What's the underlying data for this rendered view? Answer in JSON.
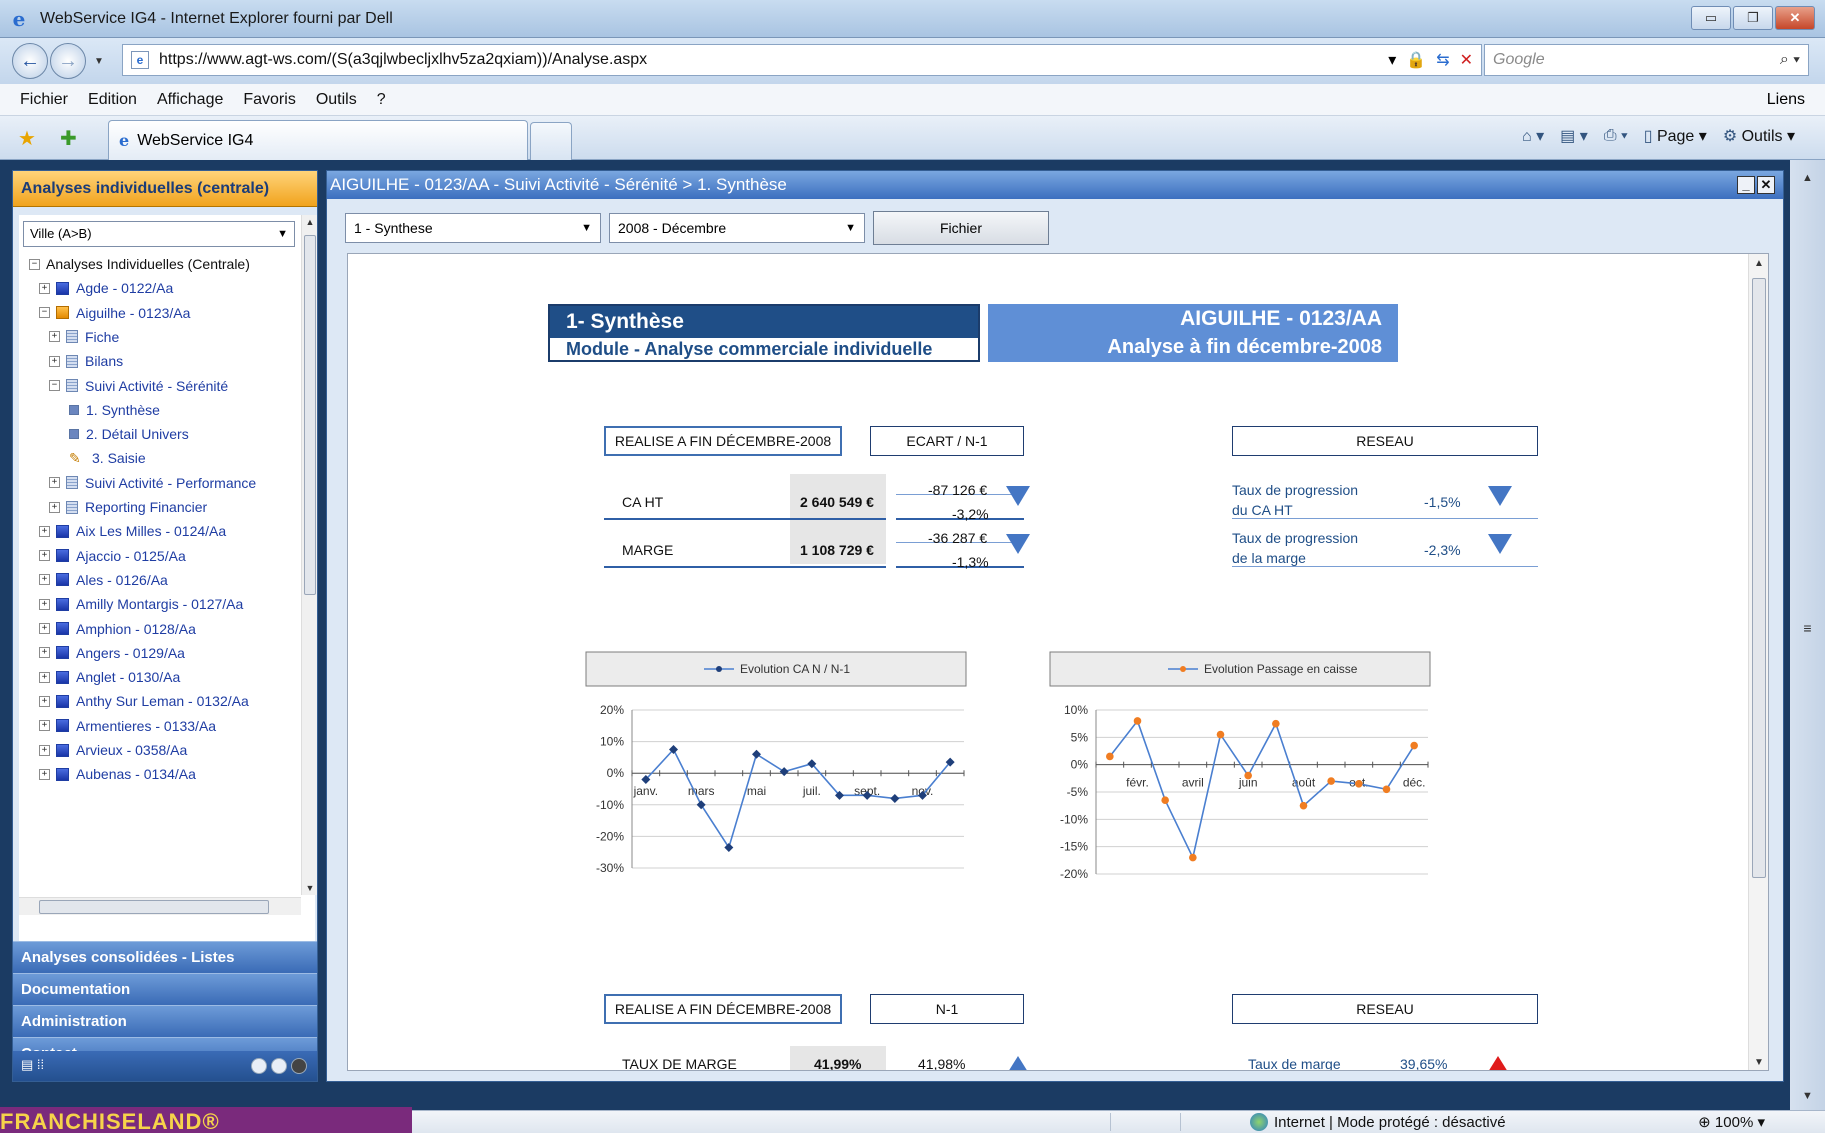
{
  "window": {
    "title": "WebService IG4 - Internet Explorer fourni par Dell",
    "minimize": "▭",
    "maximize": "❐",
    "close": "✕"
  },
  "addressbar": {
    "url": "https://www.agt-ws.com/(S(a3qjlwbecljxlhv5za2qxiam))/Analyse.aspx",
    "search_placeholder": "Google",
    "back_icon": "arrow-left",
    "forward_icon": "arrow-right"
  },
  "menubar": {
    "items": [
      "Fichier",
      "Edition",
      "Affichage",
      "Favoris",
      "Outils",
      "?"
    ],
    "liens": "Liens"
  },
  "tabs": {
    "active": "WebService IG4"
  },
  "commandbar": {
    "page": "Page",
    "outils": "Outils"
  },
  "leftpanel": {
    "header": "Analyses individuelles (centrale)",
    "city_select": "Ville (A>B)",
    "tree": [
      {
        "label": "Analyses Individuelles (Centrale)",
        "exp": "−",
        "icon": "none",
        "level": 0,
        "root": true
      },
      {
        "label": "Agde - 0122/Aa",
        "exp": "+",
        "icon": "blue",
        "level": 1
      },
      {
        "label": "Aiguilhe - 0123/Aa",
        "exp": "−",
        "icon": "orange",
        "level": 1
      },
      {
        "label": "Fiche",
        "exp": "+",
        "icon": "page",
        "level": 2
      },
      {
        "label": "Bilans",
        "exp": "+",
        "icon": "page",
        "level": 2
      },
      {
        "label": "Suivi Activité - Sérénité",
        "exp": "−",
        "icon": "page",
        "level": 2
      },
      {
        "label": "1. Synthèse",
        "exp": "",
        "icon": "small",
        "level": 3
      },
      {
        "label": "2. Détail Univers",
        "exp": "",
        "icon": "small",
        "level": 3
      },
      {
        "label": "3. Saisie",
        "exp": "",
        "icon": "pencil",
        "level": 3
      },
      {
        "label": "Suivi Activité - Performance",
        "exp": "+",
        "icon": "page",
        "level": 2
      },
      {
        "label": "Reporting Financier",
        "exp": "+",
        "icon": "page",
        "level": 2
      },
      {
        "label": "Aix Les Milles - 0124/Aa",
        "exp": "+",
        "icon": "blue",
        "level": 1
      },
      {
        "label": "Ajaccio - 0125/Aa",
        "exp": "+",
        "icon": "blue",
        "level": 1
      },
      {
        "label": "Ales - 0126/Aa",
        "exp": "+",
        "icon": "blue",
        "level": 1
      },
      {
        "label": "Amilly Montargis - 0127/Aa",
        "exp": "+",
        "icon": "blue",
        "level": 1
      },
      {
        "label": "Amphion - 0128/Aa",
        "exp": "+",
        "icon": "blue",
        "level": 1
      },
      {
        "label": "Angers - 0129/Aa",
        "exp": "+",
        "icon": "blue",
        "level": 1
      },
      {
        "label": "Anglet - 0130/Aa",
        "exp": "+",
        "icon": "blue",
        "level": 1
      },
      {
        "label": "Anthy Sur Leman - 0132/Aa",
        "exp": "+",
        "icon": "blue",
        "level": 1
      },
      {
        "label": "Armentieres - 0133/Aa",
        "exp": "+",
        "icon": "blue",
        "level": 1
      },
      {
        "label": "Arvieux - 0358/Aa",
        "exp": "+",
        "icon": "blue",
        "level": 1
      },
      {
        "label": "Aubenas - 0134/Aa",
        "exp": "+",
        "icon": "blue",
        "level": 1
      }
    ],
    "sections": [
      "Analyses consolidées - Listes",
      "Documentation",
      "Administration",
      "Contact"
    ]
  },
  "main": {
    "title": "AIGUILHE - 0123/AA - Suivi Activité - Sérénité > 1. Synthèse",
    "select_report": "1 - Synthese",
    "select_period": "2008 - Décembre",
    "fichier_button": "Fichier",
    "header_left_title": "1- Synthèse",
    "header_left_sub": "Module - Analyse commerciale individuelle",
    "header_right_title": "AIGUILHE - 0123/AA",
    "header_right_sub": "Analyse à fin décembre-2008",
    "section1": {
      "label_realise": "REALISE A FIN DÉCEMBRE-2008",
      "label_ecart": "ECART / N-1",
      "label_reseau": "RESEAU",
      "rows": [
        {
          "label": "CA HT",
          "value": "2 640 549 €",
          "ecart_abs": "-87 126 €",
          "ecart_pct": "-3,2%"
        },
        {
          "label": "MARGE",
          "value": "1 108 729 €",
          "ecart_abs": "-36 287 €",
          "ecart_pct": "-1,3%"
        }
      ],
      "reseau_rows": [
        {
          "label_l1": "Taux de progression",
          "label_l2": "du CA HT",
          "value": "-1,5%"
        },
        {
          "label_l1": "Taux de progression",
          "label_l2": "de la marge",
          "value": "-2,3%"
        }
      ]
    },
    "section2": {
      "label_realise": "REALISE A FIN DÉCEMBRE-2008",
      "label_n1": "N-1",
      "label_reseau": "RESEAU",
      "row": {
        "label": "TAUX DE MARGE",
        "value": "41,99%",
        "n1": "41,98%",
        "reseau_label": "Taux de marge",
        "reseau_value": "39,65%"
      }
    },
    "colors": {
      "line_ca": "#4a7fd0",
      "marker_ca": "#1f3f7a",
      "marker_passage": "#f07d22",
      "arrow": "#4476c4",
      "arrow_up_red": "#e01b1b"
    }
  },
  "chart_data": [
    {
      "type": "line",
      "legend": "Evolution CA N  / N-1",
      "categories": [
        "janv.",
        "févr.",
        "mars",
        "avr.",
        "mai",
        "juin",
        "juil.",
        "août",
        "sept.",
        "oct.",
        "nov.",
        "déc."
      ],
      "tick_labels": [
        "janv.",
        "mars",
        "mai",
        "juil.",
        "sept.",
        "nov."
      ],
      "values": [
        -2,
        7.5,
        -10,
        -23.5,
        6,
        0.5,
        3,
        -7,
        -7,
        -8,
        -7,
        3.5
      ],
      "ylim": [
        -30,
        20
      ],
      "yticks": [
        "20%",
        "10%",
        "0%",
        "-10%",
        "-20%",
        "-30%"
      ],
      "ytick_values": [
        20,
        10,
        0,
        -10,
        -20,
        -30
      ],
      "grid": true,
      "legend_position": "top"
    },
    {
      "type": "line",
      "legend": "Evolution Passage en caisse",
      "categories": [
        "janv.",
        "févr.",
        "mars",
        "avr.",
        "mai",
        "juin",
        "juil.",
        "août",
        "sept.",
        "oct.",
        "nov.",
        "déc."
      ],
      "tick_labels": [
        "févr.",
        "avril",
        "juin",
        "août",
        "oct.",
        "déc."
      ],
      "values": [
        1.5,
        8,
        -6.5,
        -17,
        5.5,
        -2,
        7.5,
        -7.5,
        -3,
        -3.5,
        -4.5,
        3.5
      ],
      "ylim": [
        -20,
        10
      ],
      "yticks": [
        "10%",
        "5%",
        "0%",
        "-5%",
        "-10%",
        "-15%",
        "-20%"
      ],
      "ytick_values": [
        10,
        5,
        0,
        -5,
        -10,
        -15,
        -20
      ],
      "grid": true,
      "legend_position": "top"
    }
  ],
  "statusbar": {
    "brand": "FRANCHISELAND®",
    "zone": "Internet | Mode protégé : désactivé",
    "zoom": "100%"
  }
}
